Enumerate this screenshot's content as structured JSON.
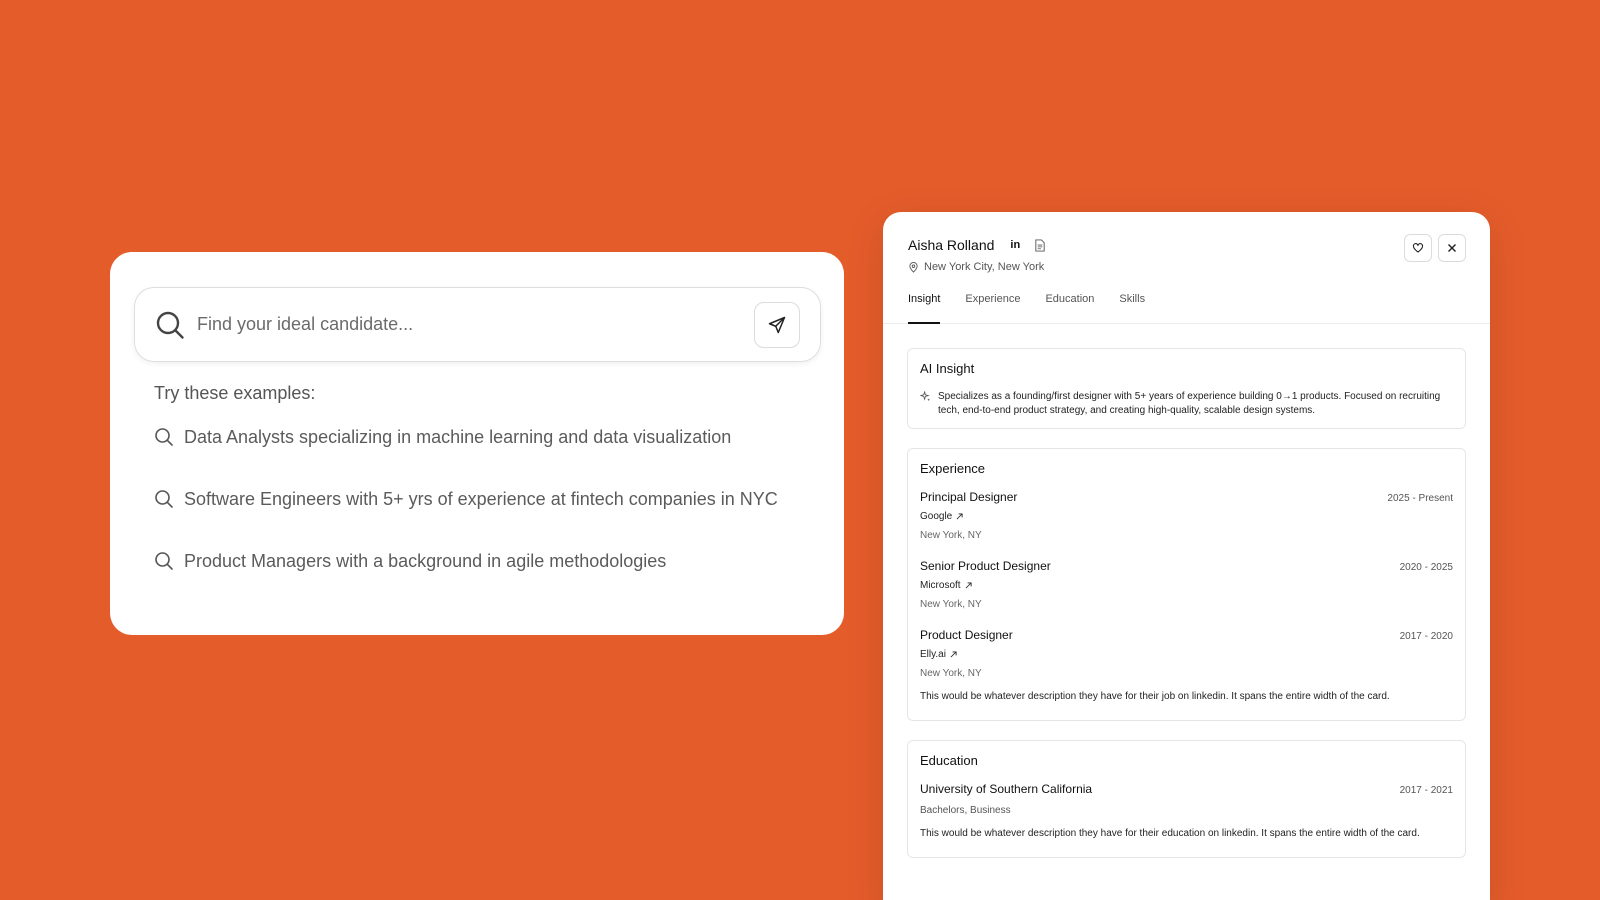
{
  "search": {
    "placeholder": "Find your ideal candidate...",
    "examples_title": "Try these examples:",
    "examples": [
      "Data Analysts specializing in machine learning and data visualization",
      "Software Engineers with 5+ yrs of experience at fintech companies in NYC",
      "Product Managers with a background in agile methodologies"
    ]
  },
  "profile": {
    "name": "Aisha Rolland",
    "linkedin_label": "in",
    "location": "New York City, New York",
    "tabs": [
      "Insight",
      "Experience",
      "Education",
      "Skills"
    ],
    "active_tab": "Insight",
    "insight": {
      "title": "AI Insight",
      "text": "Specializes as a founding/first designer with 5+ years of experience building 0→1 products. Focused on recruiting tech, end-to-end product strategy, and creating high-quality, scalable design systems."
    },
    "experience": {
      "title": "Experience",
      "jobs": [
        {
          "title": "Principal Designer",
          "dates": "2025 - Present",
          "company": "Google",
          "location": "New York, NY",
          "description": ""
        },
        {
          "title": "Senior Product Designer",
          "dates": "2020 - 2025",
          "company": "Microsoft",
          "location": "New York, NY",
          "description": ""
        },
        {
          "title": "Product Designer",
          "dates": "2017 - 2020",
          "company": "Elly.ai",
          "location": "New York, NY",
          "description": "This would be whatever description they have for their job on linkedin. It spans the entire width of the card."
        }
      ]
    },
    "education": {
      "title": "Education",
      "school": "University of Southern California",
      "dates": "2017 - 2021",
      "degree": "Bachelors, Business",
      "description": "This would be whatever description they have for their education on linkedin. It spans the entire width of the card."
    }
  },
  "colors": {
    "background": "#E55C2B",
    "card": "#FFFFFF",
    "text": "#111111",
    "muted": "#555555"
  }
}
